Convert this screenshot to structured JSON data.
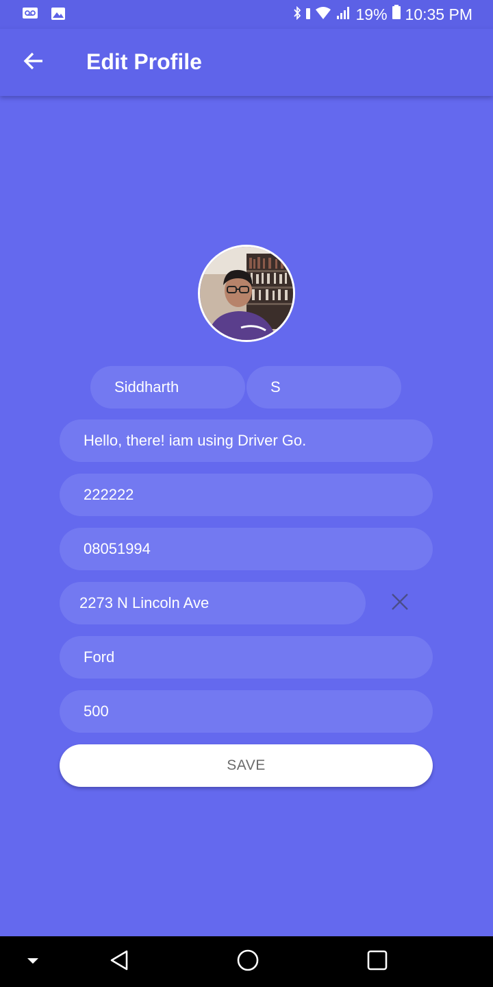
{
  "status_bar": {
    "battery": "19%",
    "time": "10:35 PM",
    "icons": [
      "voicemail-icon",
      "image-icon",
      "bluetooth-icon",
      "vibrate-icon",
      "wifi-icon",
      "signal-icon",
      "battery-icon"
    ]
  },
  "app_bar": {
    "title": "Edit Profile",
    "back_icon": "arrow-left-icon"
  },
  "profile": {
    "first_name": "Siddharth",
    "last_name": "S",
    "status": "Hello, there! iam using Driver Go.",
    "phone": "222222",
    "dob": "08051994",
    "address": "2273 N Lincoln Ave",
    "car_make": "Ford",
    "car_model": "500"
  },
  "save_label": "SAVE",
  "colors": {
    "background": "#6469ee",
    "app_bar": "#5f64ea",
    "field": "#7379f1",
    "save_button": "#ffffff"
  },
  "nav_bar": {
    "icons": [
      "nav-down-icon",
      "nav-back-icon",
      "nav-home-icon",
      "nav-recents-icon"
    ]
  }
}
